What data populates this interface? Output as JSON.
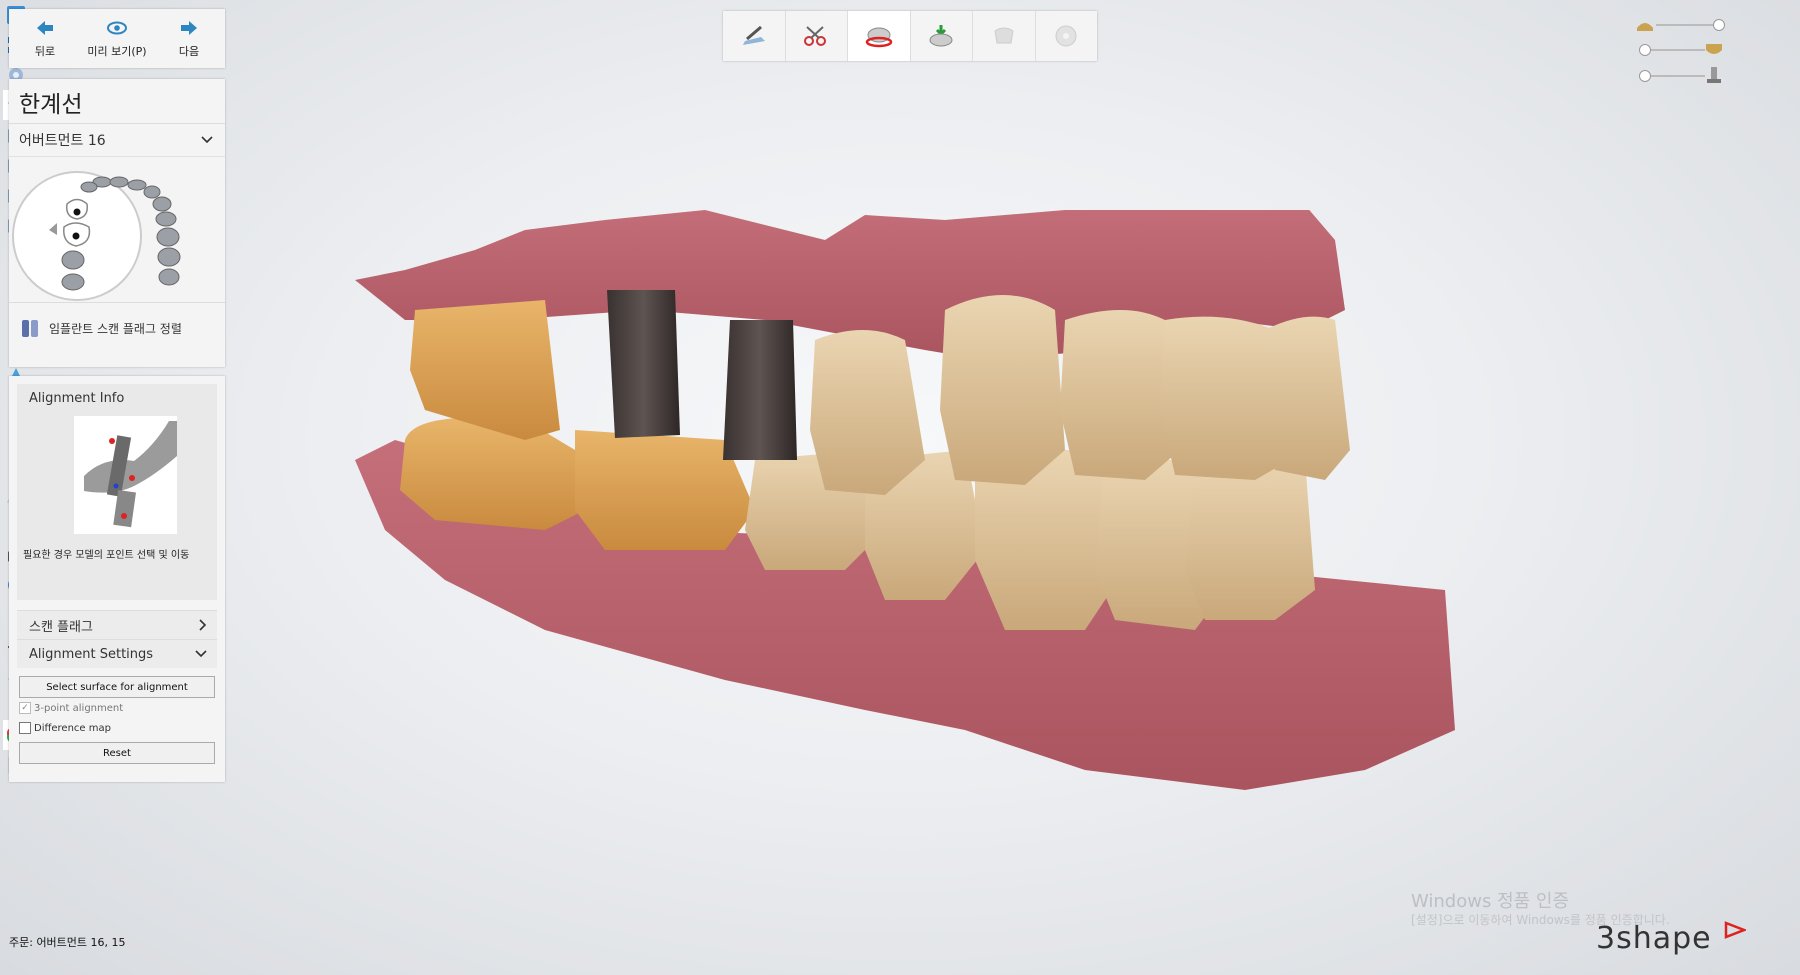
{
  "nav": {
    "back": "뒤로",
    "preview": "미리 보기(P)",
    "next": "다음"
  },
  "title": "한계선",
  "abutment_dropdown": "어버트먼트 16",
  "tool_label": "임플란트 스캔 플래그 정렬",
  "alignment_info": {
    "header": "Alignment Info",
    "description": "필요한 경우 모델의 포인트 선택 및 이동"
  },
  "scan_flag": "스캔 플래그",
  "alignment_settings": {
    "header": "Alignment Settings",
    "select_surface": "Select surface for alignment",
    "three_point": "3-point alignment",
    "difference_map": "Difference map",
    "reset": "Reset"
  },
  "order": "주문:  어버트먼트 16, 15",
  "watermark": {
    "line1": "Windows 정품 인증",
    "line2": "[설정]으로 이동하여 Windows를 정품 인증합니다."
  },
  "logo": "3shape",
  "top_toolbar": [
    "scan-prep-icon",
    "trim-icon",
    "margin-icon",
    "insertion-icon",
    "crown-icon",
    "disc-icon"
  ],
  "right_toolbar": [
    "close-icon",
    "fullscreen-icon",
    "view-rotate-icon",
    "hat-icon",
    "cube-front-icon",
    "cube-back-icon",
    "cube-left-icon",
    "cube-right-icon",
    "tool1-icon",
    "tool2-icon",
    "tool3-icon",
    "tool4-icon",
    "model-icon",
    "tool5-icon",
    "abutment-icon",
    "tooth-icon",
    "warning-icon",
    "tool6-icon",
    "camera-icon",
    "palette-icon",
    "shield-icon",
    "crosshair-icon",
    "ruler-icon",
    "print-icon",
    "color-wheel-icon",
    "az-icon"
  ],
  "colors": {
    "accent": "#2e86c1",
    "gum": "#c8707a",
    "tooth": "#e6c79a"
  }
}
